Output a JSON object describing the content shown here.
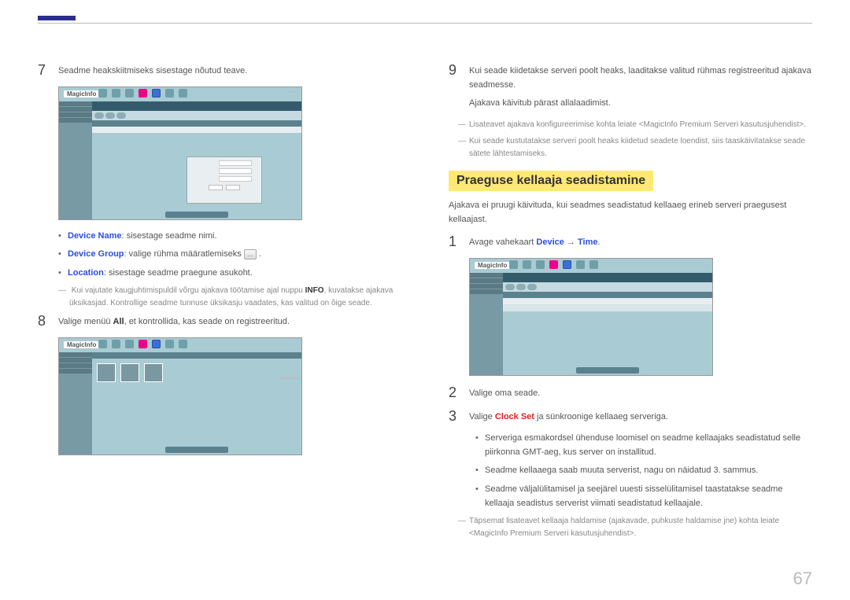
{
  "page_number": "67",
  "left": {
    "step7": {
      "num": "7",
      "text": "Seadme heakskiitmiseks sisestage nõutud teave."
    },
    "bullets": {
      "device_name_label": "Device Name",
      "device_name_text": ": sisestage seadme nimi.",
      "device_group_label": "Device Group",
      "device_group_text": ": valige rühma määratlemiseks ",
      "location_label": "Location",
      "location_text": ": sisestage seadme praegune asukoht."
    },
    "note_info_pre": "Kui vajutate kaugjuhtimispuldil võrgu ajakava töötamise ajal nuppu ",
    "note_info_bold": "INFO",
    "note_info_post": ", kuvatakse ajakava üksikasjad. Kontrollige seadme tunnuse üksikasju vaadates, kas valitud on õige seade.",
    "step8": {
      "num": "8",
      "pre": "Valige menüü ",
      "bold": "All",
      "post": ", et kontrollida, kas seade on registreeritud."
    }
  },
  "right": {
    "step9": {
      "num": "9",
      "line1": "Kui seade kiidetakse serveri poolt heaks, laaditakse valitud rühmas registreeritud ajakava seadmesse.",
      "line2": "Ajakava käivitub pärast allalaadimist."
    },
    "note1": "Lisateavet ajakava konfigureerimise kohta leiate <MagicInfo Premium Serveri kasutusjuhendist>.",
    "note2": "Kui seade kustutatakse serveri poolt heaks kiidetud seadete loendist, siis taaskäivitatakse seade sätete lähtestamiseks.",
    "section_title": "Praeguse kellaaja seadistamine",
    "section_intro": "Ajakava ei pruugi käivituda, kui seadmes seadistatud kellaaeg erineb serveri praegusest kellaajast.",
    "sub1": {
      "num": "1",
      "pre": "Avage vahekaart ",
      "link1": "Device",
      "arrow": " → ",
      "link2": "Time",
      "post": "."
    },
    "sub2": {
      "num": "2",
      "text": "Valige oma seade."
    },
    "sub3": {
      "num": "3",
      "pre": "Valige ",
      "link": "Clock Set",
      "post": " ja sünkroonige kellaaeg serveriga."
    },
    "sub_bullet1": "Serveriga esmakordsel ühenduse loomisel on seadme kellaajaks seadistatud selle piirkonna GMT-aeg, kus server on installitud.",
    "sub_bullet2": "Seadme kellaaega saab muuta serverist, nagu on näidatud 3. sammus.",
    "sub_bullet3": "Seadme väljalülitamisel ja seejärel uuesti sisselülitamisel taastatakse seadme kellaaja seadistus serverist viimati seadistatud kellaajale.",
    "bottom_note": "Täpsemat lisateavet kellaaja haldamise (ajakavade, puhkuste haldamise jne) kohta leiate <MagicInfo Premium Serveri kasutusjuhendist>."
  },
  "screenshots": {
    "logo": "MagicInfo"
  }
}
